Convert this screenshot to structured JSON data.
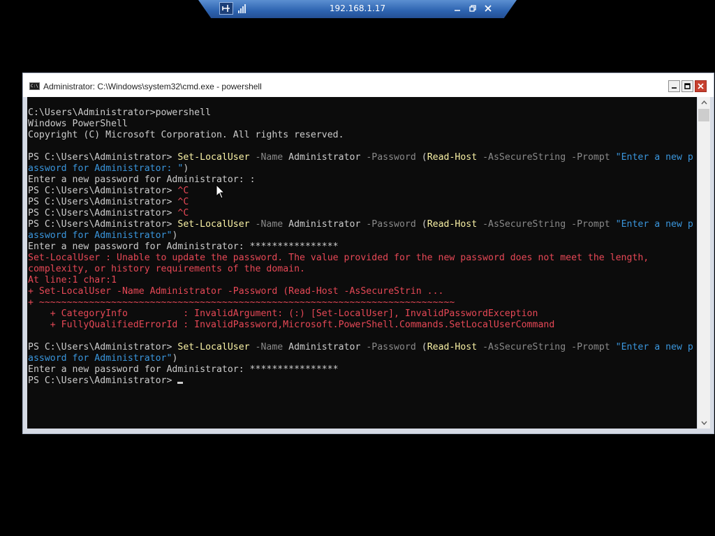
{
  "rdp_bar": {
    "host": "192.168.1.17"
  },
  "window": {
    "title": "Administrator: C:\\Windows\\system32\\cmd.exe - powershell",
    "icon_text": "C:\\"
  },
  "terminal": {
    "colors": {
      "background": "#0c0c0c",
      "text": "#cccccc",
      "command": "#f9f1a5",
      "parameter": "#8a8a8a",
      "string": "#3a96dd",
      "error": "#e74856"
    },
    "lines": [
      [
        {
          "t": "C:\\Users\\Administrator>powershell",
          "c": "white"
        }
      ],
      [
        {
          "t": "Windows PowerShell",
          "c": "white"
        }
      ],
      [
        {
          "t": "Copyright (C) Microsoft Corporation. All rights reserved.",
          "c": "white"
        }
      ],
      [
        {
          "t": "",
          "c": "white"
        }
      ],
      [
        {
          "t": "PS C:\\Users\\Administrator> ",
          "c": "white"
        },
        {
          "t": "Set-LocalUser",
          "c": "yellow"
        },
        {
          "t": " -Name ",
          "c": "gray"
        },
        {
          "t": "Administrator",
          "c": "white"
        },
        {
          "t": " -Password ",
          "c": "gray"
        },
        {
          "t": "(",
          "c": "white"
        },
        {
          "t": "Read-Host",
          "c": "yellow"
        },
        {
          "t": " -AsSecureString -Prompt ",
          "c": "gray"
        },
        {
          "t": "\"Enter a new p",
          "c": "blue"
        }
      ],
      [
        {
          "t": "assword for Administrator: \"",
          "c": "blue"
        },
        {
          "t": ")",
          "c": "white"
        }
      ],
      [
        {
          "t": "Enter a new password for Administrator: :",
          "c": "white"
        }
      ],
      [
        {
          "t": "PS C:\\Users\\Administrator> ",
          "c": "white"
        },
        {
          "t": "^C",
          "c": "red"
        }
      ],
      [
        {
          "t": "PS C:\\Users\\Administrator> ",
          "c": "white"
        },
        {
          "t": "^C",
          "c": "red"
        }
      ],
      [
        {
          "t": "PS C:\\Users\\Administrator> ",
          "c": "white"
        },
        {
          "t": "^C",
          "c": "red"
        }
      ],
      [
        {
          "t": "PS C:\\Users\\Administrator> ",
          "c": "white"
        },
        {
          "t": "Set-LocalUser",
          "c": "yellow"
        },
        {
          "t": " -Name ",
          "c": "gray"
        },
        {
          "t": "Administrator",
          "c": "white"
        },
        {
          "t": " -Password ",
          "c": "gray"
        },
        {
          "t": "(",
          "c": "white"
        },
        {
          "t": "Read-Host",
          "c": "yellow"
        },
        {
          "t": " -AsSecureString -Prompt ",
          "c": "gray"
        },
        {
          "t": "\"Enter a new p",
          "c": "blue"
        }
      ],
      [
        {
          "t": "assword for Administrator\"",
          "c": "blue"
        },
        {
          "t": ")",
          "c": "white"
        }
      ],
      [
        {
          "t": "Enter a new password for Administrator: ****************",
          "c": "white"
        }
      ],
      [
        {
          "t": "Set-LocalUser : Unable to update the password. The value provided for the new password does not meet the length,",
          "c": "red"
        }
      ],
      [
        {
          "t": "complexity, or history requirements of the domain.",
          "c": "red"
        }
      ],
      [
        {
          "t": "At line:1 char:1",
          "c": "red"
        }
      ],
      [
        {
          "t": "+ Set-LocalUser -Name Administrator -Password (Read-Host -AsSecureStrin ...",
          "c": "red"
        }
      ],
      [
        {
          "t": "+ ~~~~~~~~~~~~~~~~~~~~~~~~~~~~~~~~~~~~~~~~~~~~~~~~~~~~~~~~~~~~~~~~~~~~~~~~~~~",
          "c": "red"
        }
      ],
      [
        {
          "t": "    + CategoryInfo          : InvalidArgument: (:) [Set-LocalUser], InvalidPasswordException",
          "c": "red"
        }
      ],
      [
        {
          "t": "    + FullyQualifiedErrorId : InvalidPassword,Microsoft.PowerShell.Commands.SetLocalUserCommand",
          "c": "red"
        }
      ],
      [
        {
          "t": "",
          "c": "white"
        }
      ],
      [
        {
          "t": "PS C:\\Users\\Administrator> ",
          "c": "white"
        },
        {
          "t": "Set-LocalUser",
          "c": "yellow"
        },
        {
          "t": " -Name ",
          "c": "gray"
        },
        {
          "t": "Administrator",
          "c": "white"
        },
        {
          "t": " -Password ",
          "c": "gray"
        },
        {
          "t": "(",
          "c": "white"
        },
        {
          "t": "Read-Host",
          "c": "yellow"
        },
        {
          "t": " -AsSecureString -Prompt ",
          "c": "gray"
        },
        {
          "t": "\"Enter a new p",
          "c": "blue"
        }
      ],
      [
        {
          "t": "assword for Administrator\"",
          "c": "blue"
        },
        {
          "t": ")",
          "c": "white"
        }
      ],
      [
        {
          "t": "Enter a new password for Administrator: ****************",
          "c": "white"
        }
      ],
      [
        {
          "t": "PS C:\\Users\\Administrator> ",
          "c": "white"
        }
      ]
    ]
  }
}
